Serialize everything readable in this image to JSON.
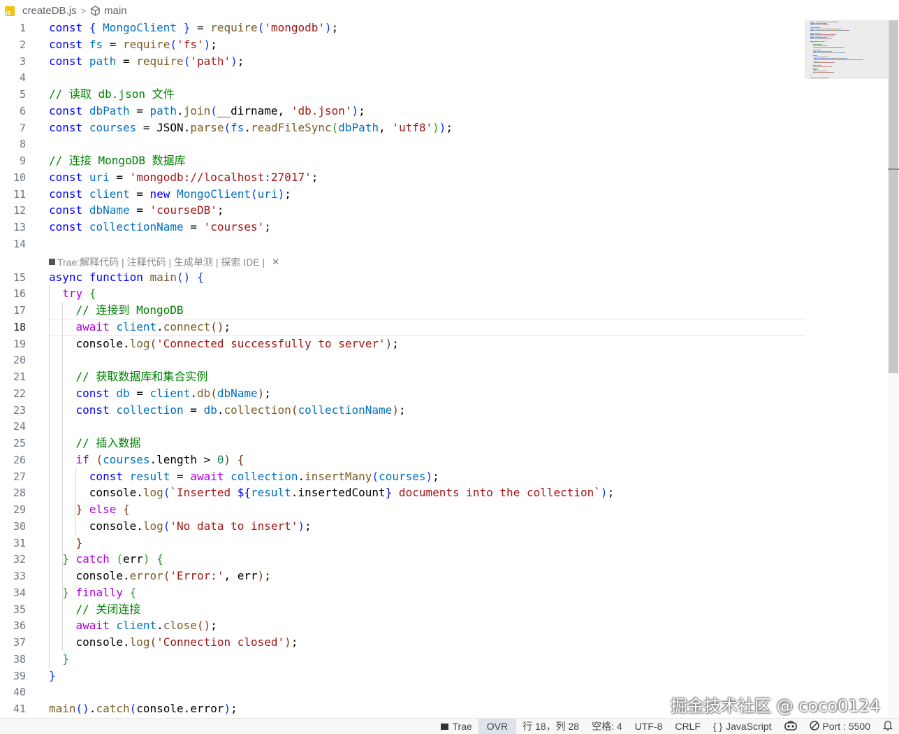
{
  "breadcrumb": {
    "file_icon_text": "JS",
    "file": "createDB.js",
    "separator": ">",
    "symbol": "main"
  },
  "codelens": {
    "prefix": "Trae: ",
    "actions": [
      "解释代码",
      "注释代码",
      "生成单测",
      "探索 IDE"
    ],
    "separator": " | ",
    "close_glyph": "✕"
  },
  "editor": {
    "active_line": 18,
    "lines": [
      {
        "n": 1,
        "t": [
          [
            "kw",
            "const"
          ],
          [
            "p",
            " "
          ],
          [
            "b1",
            "{"
          ],
          [
            "p",
            " "
          ],
          [
            "var",
            "MongoClient"
          ],
          [
            "p",
            " "
          ],
          [
            "b1",
            "}"
          ],
          [
            "p",
            " = "
          ],
          [
            "fn",
            "require"
          ],
          [
            "b1",
            "("
          ],
          [
            "str",
            "'mongodb'"
          ],
          [
            "b1",
            ")"
          ],
          [
            "p",
            ";"
          ]
        ]
      },
      {
        "n": 2,
        "t": [
          [
            "kw",
            "const"
          ],
          [
            "p",
            " "
          ],
          [
            "var",
            "fs"
          ],
          [
            "p",
            " = "
          ],
          [
            "fn",
            "require"
          ],
          [
            "b1",
            "("
          ],
          [
            "str",
            "'fs'"
          ],
          [
            "b1",
            ")"
          ],
          [
            "p",
            ";"
          ]
        ]
      },
      {
        "n": 3,
        "t": [
          [
            "kw",
            "const"
          ],
          [
            "p",
            " "
          ],
          [
            "var",
            "path"
          ],
          [
            "p",
            " = "
          ],
          [
            "fn",
            "require"
          ],
          [
            "b1",
            "("
          ],
          [
            "str",
            "'path'"
          ],
          [
            "b1",
            ")"
          ],
          [
            "p",
            ";"
          ]
        ]
      },
      {
        "n": 4,
        "t": []
      },
      {
        "n": 5,
        "t": [
          [
            "com",
            "// 读取 db.json 文件"
          ]
        ]
      },
      {
        "n": 6,
        "t": [
          [
            "kw",
            "const"
          ],
          [
            "p",
            " "
          ],
          [
            "var",
            "dbPath"
          ],
          [
            "p",
            " = "
          ],
          [
            "var",
            "path"
          ],
          [
            "p",
            "."
          ],
          [
            "fn",
            "join"
          ],
          [
            "b1",
            "("
          ],
          [
            "p",
            "__dirname, "
          ],
          [
            "str",
            "'db.json'"
          ],
          [
            "b1",
            ")"
          ],
          [
            "p",
            ";"
          ]
        ]
      },
      {
        "n": 7,
        "t": [
          [
            "kw",
            "const"
          ],
          [
            "p",
            " "
          ],
          [
            "var",
            "courses"
          ],
          [
            "p",
            " = "
          ],
          [
            "p",
            "JSON."
          ],
          [
            "fn",
            "parse"
          ],
          [
            "b1",
            "("
          ],
          [
            "var",
            "fs"
          ],
          [
            "p",
            "."
          ],
          [
            "fn",
            "readFileSync"
          ],
          [
            "b2",
            "("
          ],
          [
            "var",
            "dbPath"
          ],
          [
            "p",
            ", "
          ],
          [
            "str",
            "'utf8'"
          ],
          [
            "b2",
            ")"
          ],
          [
            "b1",
            ")"
          ],
          [
            "p",
            ";"
          ]
        ]
      },
      {
        "n": 8,
        "t": []
      },
      {
        "n": 9,
        "t": [
          [
            "com",
            "// 连接 MongoDB 数据库"
          ]
        ]
      },
      {
        "n": 10,
        "t": [
          [
            "kw",
            "const"
          ],
          [
            "p",
            " "
          ],
          [
            "var",
            "uri"
          ],
          [
            "p",
            " = "
          ],
          [
            "str",
            "'mongodb://localhost:27017'"
          ],
          [
            "p",
            ";"
          ]
        ]
      },
      {
        "n": 11,
        "t": [
          [
            "kw",
            "const"
          ],
          [
            "p",
            " "
          ],
          [
            "var",
            "client"
          ],
          [
            "p",
            " = "
          ],
          [
            "kw",
            "new"
          ],
          [
            "p",
            " "
          ],
          [
            "var",
            "MongoClient"
          ],
          [
            "b1",
            "("
          ],
          [
            "var",
            "uri"
          ],
          [
            "b1",
            ")"
          ],
          [
            "p",
            ";"
          ]
        ]
      },
      {
        "n": 12,
        "t": [
          [
            "kw",
            "const"
          ],
          [
            "p",
            " "
          ],
          [
            "var",
            "dbName"
          ],
          [
            "p",
            " = "
          ],
          [
            "str",
            "'courseDB'"
          ],
          [
            "p",
            ";"
          ]
        ]
      },
      {
        "n": 13,
        "t": [
          [
            "kw",
            "const"
          ],
          [
            "p",
            " "
          ],
          [
            "var",
            "collectionName"
          ],
          [
            "p",
            " = "
          ],
          [
            "str",
            "'courses'"
          ],
          [
            "p",
            ";"
          ]
        ]
      },
      {
        "n": 14,
        "t": []
      },
      {
        "n": 15,
        "t": [
          [
            "kw",
            "async"
          ],
          [
            "p",
            " "
          ],
          [
            "kw",
            "function"
          ],
          [
            "p",
            " "
          ],
          [
            "fn",
            "main"
          ],
          [
            "b1",
            "()"
          ],
          [
            "p",
            " "
          ],
          [
            "b1",
            "{"
          ]
        ]
      },
      {
        "n": 16,
        "t": [
          [
            "p",
            "  "
          ],
          [
            "ctl",
            "try"
          ],
          [
            "p",
            " "
          ],
          [
            "b2",
            "{"
          ]
        ]
      },
      {
        "n": 17,
        "t": [
          [
            "p",
            "    "
          ],
          [
            "com",
            "// 连接到 MongoDB"
          ]
        ]
      },
      {
        "n": 18,
        "t": [
          [
            "p",
            "    "
          ],
          [
            "ctl",
            "await"
          ],
          [
            "p",
            " "
          ],
          [
            "var",
            "client"
          ],
          [
            "p",
            "."
          ],
          [
            "fn",
            "connect"
          ],
          [
            "b3",
            "()"
          ],
          [
            "p",
            ";"
          ]
        ]
      },
      {
        "n": 19,
        "t": [
          [
            "p",
            "    "
          ],
          [
            "p",
            "console."
          ],
          [
            "fn",
            "log"
          ],
          [
            "b3",
            "("
          ],
          [
            "str",
            "'Connected successfully to server'"
          ],
          [
            "b3",
            ")"
          ],
          [
            "p",
            ";"
          ]
        ]
      },
      {
        "n": 20,
        "t": []
      },
      {
        "n": 21,
        "t": [
          [
            "p",
            "    "
          ],
          [
            "com",
            "// 获取数据库和集合实例"
          ]
        ]
      },
      {
        "n": 22,
        "t": [
          [
            "p",
            "    "
          ],
          [
            "kw",
            "const"
          ],
          [
            "p",
            " "
          ],
          [
            "var",
            "db"
          ],
          [
            "p",
            " = "
          ],
          [
            "var",
            "client"
          ],
          [
            "p",
            "."
          ],
          [
            "fn",
            "db"
          ],
          [
            "b3",
            "("
          ],
          [
            "var",
            "dbName"
          ],
          [
            "b3",
            ")"
          ],
          [
            "p",
            ";"
          ]
        ]
      },
      {
        "n": 23,
        "t": [
          [
            "p",
            "    "
          ],
          [
            "kw",
            "const"
          ],
          [
            "p",
            " "
          ],
          [
            "var",
            "collection"
          ],
          [
            "p",
            " = "
          ],
          [
            "var",
            "db"
          ],
          [
            "p",
            "."
          ],
          [
            "fn",
            "collection"
          ],
          [
            "b3",
            "("
          ],
          [
            "var",
            "collectionName"
          ],
          [
            "b3",
            ")"
          ],
          [
            "p",
            ";"
          ]
        ]
      },
      {
        "n": 24,
        "t": []
      },
      {
        "n": 25,
        "t": [
          [
            "p",
            "    "
          ],
          [
            "com",
            "// 插入数据"
          ]
        ]
      },
      {
        "n": 26,
        "t": [
          [
            "p",
            "    "
          ],
          [
            "ctl",
            "if"
          ],
          [
            "p",
            " "
          ],
          [
            "b3",
            "("
          ],
          [
            "var",
            "courses"
          ],
          [
            "p",
            ".length > "
          ],
          [
            "num",
            "0"
          ],
          [
            "b3",
            ")"
          ],
          [
            "p",
            " "
          ],
          [
            "b3",
            "{"
          ]
        ]
      },
      {
        "n": 27,
        "t": [
          [
            "p",
            "      "
          ],
          [
            "kw",
            "const"
          ],
          [
            "p",
            " "
          ],
          [
            "var",
            "result"
          ],
          [
            "p",
            " = "
          ],
          [
            "ctl",
            "await"
          ],
          [
            "p",
            " "
          ],
          [
            "var",
            "collection"
          ],
          [
            "p",
            "."
          ],
          [
            "fn",
            "insertMany"
          ],
          [
            "b1",
            "("
          ],
          [
            "var",
            "courses"
          ],
          [
            "b1",
            ")"
          ],
          [
            "p",
            ";"
          ]
        ]
      },
      {
        "n": 28,
        "t": [
          [
            "p",
            "      "
          ],
          [
            "p",
            "console."
          ],
          [
            "fn",
            "log"
          ],
          [
            "b1",
            "("
          ],
          [
            "str",
            "`Inserted "
          ],
          [
            "tpl",
            "${"
          ],
          [
            "var",
            "result"
          ],
          [
            "p",
            ".insertedCount"
          ],
          [
            "tpl",
            "}"
          ],
          [
            "str",
            " documents into the collection`"
          ],
          [
            "b1",
            ")"
          ],
          [
            "p",
            ";"
          ]
        ]
      },
      {
        "n": 29,
        "t": [
          [
            "p",
            "    "
          ],
          [
            "b3",
            "}"
          ],
          [
            "p",
            " "
          ],
          [
            "ctl",
            "else"
          ],
          [
            "p",
            " "
          ],
          [
            "b3",
            "{"
          ]
        ]
      },
      {
        "n": 30,
        "t": [
          [
            "p",
            "      "
          ],
          [
            "p",
            "console."
          ],
          [
            "fn",
            "log"
          ],
          [
            "b1",
            "("
          ],
          [
            "str",
            "'No data to insert'"
          ],
          [
            "b1",
            ")"
          ],
          [
            "p",
            ";"
          ]
        ]
      },
      {
        "n": 31,
        "t": [
          [
            "p",
            "    "
          ],
          [
            "b3",
            "}"
          ]
        ]
      },
      {
        "n": 32,
        "t": [
          [
            "p",
            "  "
          ],
          [
            "b2",
            "}"
          ],
          [
            "p",
            " "
          ],
          [
            "ctl",
            "catch"
          ],
          [
            "p",
            " "
          ],
          [
            "b2",
            "("
          ],
          [
            "p",
            "err"
          ],
          [
            "b2",
            ")"
          ],
          [
            "p",
            " "
          ],
          [
            "b2",
            "{"
          ]
        ]
      },
      {
        "n": 33,
        "t": [
          [
            "p",
            "    "
          ],
          [
            "p",
            "console."
          ],
          [
            "fn",
            "error"
          ],
          [
            "b3",
            "("
          ],
          [
            "str",
            "'Error:'"
          ],
          [
            "p",
            ", err"
          ],
          [
            "b3",
            ")"
          ],
          [
            "p",
            ";"
          ]
        ]
      },
      {
        "n": 34,
        "t": [
          [
            "p",
            "  "
          ],
          [
            "b2",
            "}"
          ],
          [
            "p",
            " "
          ],
          [
            "ctl",
            "finally"
          ],
          [
            "p",
            " "
          ],
          [
            "b2",
            "{"
          ]
        ]
      },
      {
        "n": 35,
        "t": [
          [
            "p",
            "    "
          ],
          [
            "com",
            "// 关闭连接"
          ]
        ]
      },
      {
        "n": 36,
        "t": [
          [
            "p",
            "    "
          ],
          [
            "ctl",
            "await"
          ],
          [
            "p",
            " "
          ],
          [
            "var",
            "client"
          ],
          [
            "p",
            "."
          ],
          [
            "fn",
            "close"
          ],
          [
            "b3",
            "()"
          ],
          [
            "p",
            ";"
          ]
        ]
      },
      {
        "n": 37,
        "t": [
          [
            "p",
            "    "
          ],
          [
            "p",
            "console."
          ],
          [
            "fn",
            "log"
          ],
          [
            "b3",
            "("
          ],
          [
            "str",
            "'Connection closed'"
          ],
          [
            "b3",
            ")"
          ],
          [
            "p",
            ";"
          ]
        ]
      },
      {
        "n": 38,
        "t": [
          [
            "p",
            "  "
          ],
          [
            "b2",
            "}"
          ]
        ]
      },
      {
        "n": 39,
        "t": [
          [
            "b1",
            "}"
          ]
        ]
      },
      {
        "n": 40,
        "t": []
      },
      {
        "n": 41,
        "t": [
          [
            "fn",
            "main"
          ],
          [
            "b1",
            "()"
          ],
          [
            "p",
            "."
          ],
          [
            "fn",
            "catch"
          ],
          [
            "b1",
            "("
          ],
          [
            "p",
            "console.error"
          ],
          [
            "b1",
            ")"
          ],
          [
            "p",
            ";"
          ]
        ]
      }
    ]
  },
  "statusbar": {
    "trae": "Trae",
    "ovr": "OVR",
    "position": "行 18，列 28",
    "indent": "空格: 4",
    "encoding": "UTF-8",
    "eol": "CRLF",
    "language_icon": "{ }",
    "language": "JavaScript",
    "port": "Port : 5500"
  },
  "watermark": "掘金技术社区 @ coco0124",
  "colors": {
    "keyword": "#0000ff",
    "control": "#af00db",
    "variable": "#0070c1",
    "string": "#a31515",
    "function": "#795e26",
    "comment": "#008000",
    "number": "#098658"
  }
}
